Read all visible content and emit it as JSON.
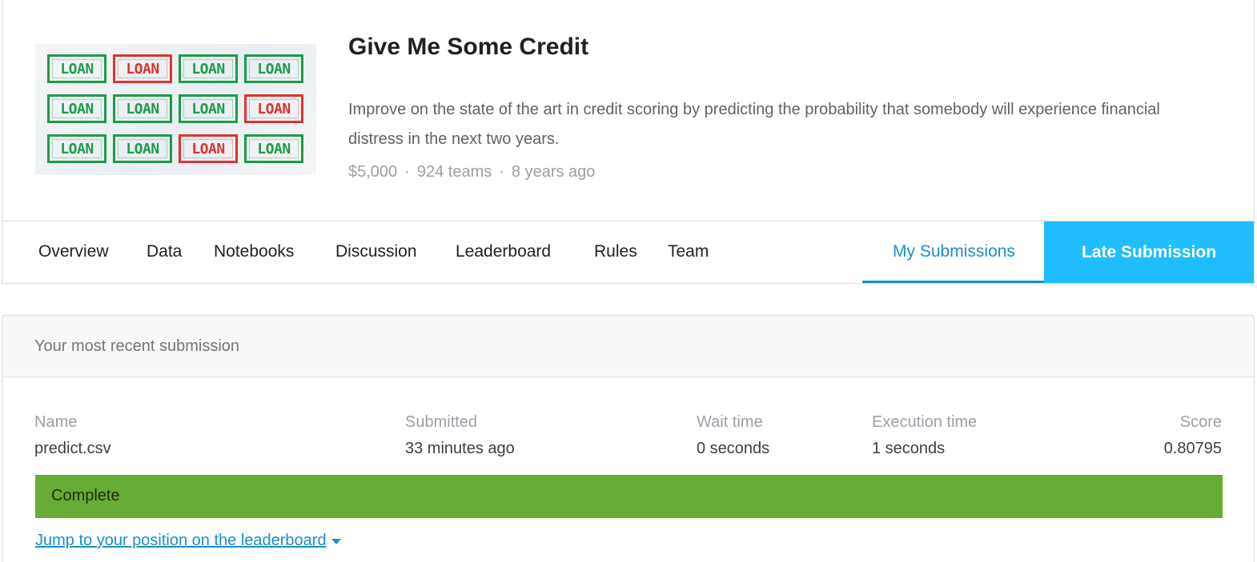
{
  "competition": {
    "title": "Give Me Some Credit",
    "description": "Improve on the state of the art in credit scoring by predicting the probability that somebody will experience financial distress in the next two years.",
    "prize": "$5,000",
    "teams": "924 teams",
    "age": "8 years ago",
    "banner": {
      "word": "LOAN",
      "colors": {
        "green": "#1f9a4b",
        "red": "#e0322d"
      },
      "rows": [
        [
          "green",
          "red",
          "green",
          "green"
        ],
        [
          "green",
          "green",
          "green",
          "red"
        ],
        [
          "green",
          "green",
          "red",
          "green"
        ]
      ]
    }
  },
  "tabs": [
    {
      "label": "Overview"
    },
    {
      "label": "Data"
    },
    {
      "label": "Notebooks"
    },
    {
      "label": "Discussion"
    },
    {
      "label": "Leaderboard"
    },
    {
      "label": "Rules"
    },
    {
      "label": "Team"
    }
  ],
  "my_submissions_tab": {
    "label": "My Submissions",
    "active": true
  },
  "late_submission_button": {
    "label": "Late Submission"
  },
  "submission": {
    "header": "Your most recent submission",
    "columns": {
      "name": "Name",
      "submitted": "Submitted",
      "wait": "Wait time",
      "execution": "Execution time",
      "score": "Score"
    },
    "values": {
      "name": "predict.csv",
      "submitted": "33 minutes ago",
      "wait": "0 seconds",
      "execution": "1 seconds",
      "score": "0.80795"
    },
    "status": "Complete",
    "jump_link": "Jump to your position on the leaderboard"
  },
  "colors": {
    "accent": "#1a8fc7",
    "late_button_bg": "#20beff",
    "status_complete": "#67ac35"
  }
}
